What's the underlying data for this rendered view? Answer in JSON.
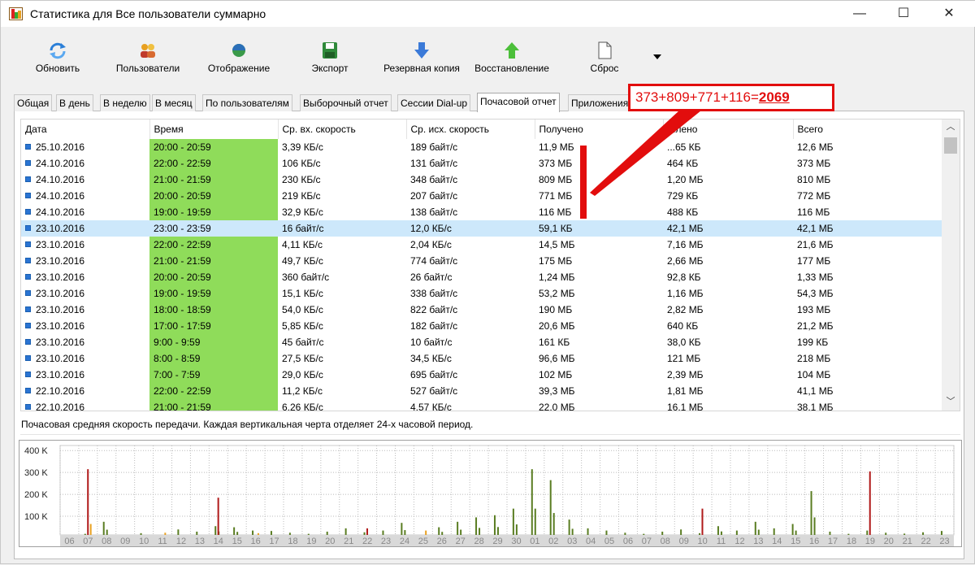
{
  "window": {
    "title": "Статистика для Все пользователи суммарно",
    "minimize": "—",
    "maximize": "☐",
    "close": "✕"
  },
  "toolbar": {
    "refresh": "Обновить",
    "users": "Пользователи",
    "display": "Отображение",
    "export": "Экспорт",
    "backup": "Резервная копия",
    "restore": "Восстановление",
    "reset": "Сброс"
  },
  "tabs": [
    "Общая",
    "В день",
    "В неделю",
    "В месяц",
    "По пользователям",
    "Выборочный отчет",
    "Сессии Dial-up",
    "Почасовой отчет",
    "Приложения"
  ],
  "active_tab": "Почасовой отчет",
  "table": {
    "columns": [
      "Дата",
      "Время",
      "Ср. вх. скорость",
      "Ср. исх. скорость",
      "Получено",
      "Отправлено",
      "Всего"
    ],
    "columns_visible": [
      "Дата",
      "Время",
      "Ср. вх. скорость",
      "Ср. исх. скорость",
      "Получено",
      "...лено",
      "Всего"
    ],
    "rows": [
      {
        "date": "25.10.2016",
        "time": "20:00 - 20:59",
        "in": "3,39 КБ/с",
        "out": "189 байт/с",
        "recv": "11,9 МБ",
        "sent": "...65 КБ",
        "total": "12,6 МБ"
      },
      {
        "date": "24.10.2016",
        "time": "22:00 - 22:59",
        "in": "106 КБ/с",
        "out": "131 байт/с",
        "recv": "373 МБ",
        "sent": "464 КБ",
        "total": "373 МБ"
      },
      {
        "date": "24.10.2016",
        "time": "21:00 - 21:59",
        "in": "230 КБ/с",
        "out": "348 байт/с",
        "recv": "809 МБ",
        "sent": "1,20 МБ",
        "total": "810 МБ"
      },
      {
        "date": "24.10.2016",
        "time": "20:00 - 20:59",
        "in": "219 КБ/с",
        "out": "207 байт/с",
        "recv": "771 МБ",
        "sent": "729 КБ",
        "total": "772 МБ"
      },
      {
        "date": "24.10.2016",
        "time": "19:00 - 19:59",
        "in": "32,9 КБ/с",
        "out": "138 байт/с",
        "recv": "116 МБ",
        "sent": "488 КБ",
        "total": "116 МБ"
      },
      {
        "date": "23.10.2016",
        "time": "23:00 - 23:59",
        "in": "16 байт/с",
        "out": "12,0 КБ/с",
        "recv": "59,1 КБ",
        "sent": "42,1 МБ",
        "total": "42,1 МБ",
        "selected": true
      },
      {
        "date": "23.10.2016",
        "time": "22:00 - 22:59",
        "in": "4,11 КБ/с",
        "out": "2,04 КБ/с",
        "recv": "14,5 МБ",
        "sent": "7,16 МБ",
        "total": "21,6 МБ"
      },
      {
        "date": "23.10.2016",
        "time": "21:00 - 21:59",
        "in": "49,7 КБ/с",
        "out": "774 байт/с",
        "recv": "175 МБ",
        "sent": "2,66 МБ",
        "total": "177 МБ"
      },
      {
        "date": "23.10.2016",
        "time": "20:00 - 20:59",
        "in": "360 байт/с",
        "out": "26 байт/с",
        "recv": "1,24 МБ",
        "sent": "92,8 КБ",
        "total": "1,33 МБ"
      },
      {
        "date": "23.10.2016",
        "time": "19:00 - 19:59",
        "in": "15,1 КБ/с",
        "out": "338 байт/с",
        "recv": "53,2 МБ",
        "sent": "1,16 МБ",
        "total": "54,3 МБ"
      },
      {
        "date": "23.10.2016",
        "time": "18:00 - 18:59",
        "in": "54,0 КБ/с",
        "out": "822 байт/с",
        "recv": "190 МБ",
        "sent": "2,82 МБ",
        "total": "193 МБ"
      },
      {
        "date": "23.10.2016",
        "time": "17:00 - 17:59",
        "in": "5,85 КБ/с",
        "out": "182 байт/с",
        "recv": "20,6 МБ",
        "sent": "640 КБ",
        "total": "21,2 МБ"
      },
      {
        "date": "23.10.2016",
        "time": "9:00 - 9:59",
        "in": "45 байт/с",
        "out": "10 байт/с",
        "recv": "161 КБ",
        "sent": "38,0 КБ",
        "total": "199 КБ"
      },
      {
        "date": "23.10.2016",
        "time": "8:00 - 8:59",
        "in": "27,5 КБ/с",
        "out": "34,5 КБ/с",
        "recv": "96,6 МБ",
        "sent": "121 МБ",
        "total": "218 МБ"
      },
      {
        "date": "23.10.2016",
        "time": "7:00 - 7:59",
        "in": "29,0 КБ/с",
        "out": "695 байт/с",
        "recv": "102 МБ",
        "sent": "2,39 МБ",
        "total": "104 МБ"
      },
      {
        "date": "22.10.2016",
        "time": "22:00 - 22:59",
        "in": "11,2 КБ/с",
        "out": "527 байт/с",
        "recv": "39,3 МБ",
        "sent": "1,81 МБ",
        "total": "41,1 МБ"
      },
      {
        "date": "22.10.2016",
        "time": "21:00 - 21:59",
        "in": "6,26 КБ/с",
        "out": "4,57 КБ/с",
        "recv": "22,0 МБ",
        "sent": "16,1 МБ",
        "total": "38,1 МБ"
      }
    ]
  },
  "status_text": "Почасовая средняя скорость передачи. Каждая вертикальная черта отделяет 24-х часовой период.",
  "annotation": {
    "expr": "373+809+771+116=",
    "result": "2069",
    "color": "#e20d0d"
  },
  "chart_data": {
    "type": "bar",
    "y_ticks": [
      "400 K",
      "300 K",
      "200 K",
      "100 K"
    ],
    "ylim": [
      0,
      400
    ],
    "x_ticks": [
      "06",
      "07",
      "08",
      "09",
      "10",
      "11",
      "12",
      "13",
      "14",
      "15",
      "16",
      "17",
      "18",
      "19",
      "20",
      "21",
      "22",
      "23",
      "24",
      "25",
      "26",
      "27",
      "28",
      "29",
      "30",
      "01",
      "02",
      "03",
      "04",
      "05",
      "06",
      "07",
      "08",
      "09",
      "10",
      "11",
      "12",
      "13",
      "14",
      "15",
      "16",
      "17",
      "18",
      "19",
      "20",
      "21",
      "22",
      "23"
    ],
    "series": [
      {
        "color": "#5a7d22",
        "values": [
          0,
          5,
          60,
          0,
          8,
          0,
          25,
          15,
          40,
          35,
          20,
          18,
          10,
          5,
          15,
          30,
          12,
          20,
          55,
          0,
          35,
          60,
          80,
          90,
          120,
          300,
          250,
          70,
          30,
          20,
          10,
          5,
          15,
          25,
          8,
          40,
          20,
          60,
          30,
          50,
          200,
          15,
          5,
          20,
          10,
          6,
          12,
          18
        ]
      },
      {
        "color": "#b01a1a",
        "values": [
          0,
          300,
          0,
          0,
          0,
          0,
          0,
          0,
          170,
          0,
          0,
          0,
          0,
          0,
          0,
          0,
          30,
          0,
          0,
          0,
          0,
          0,
          0,
          0,
          0,
          0,
          0,
          0,
          0,
          0,
          0,
          0,
          0,
          0,
          120,
          0,
          0,
          0,
          0,
          0,
          0,
          0,
          0,
          290,
          0,
          0,
          0,
          0
        ]
      },
      {
        "color": "#e8a020",
        "values": [
          0,
          50,
          0,
          0,
          0,
          10,
          0,
          0,
          0,
          0,
          8,
          0,
          0,
          0,
          0,
          0,
          0,
          0,
          0,
          20,
          0,
          0,
          0,
          0,
          0,
          0,
          0,
          0,
          0,
          0,
          0,
          0,
          0,
          0,
          0,
          0,
          0,
          0,
          0,
          0,
          0,
          0,
          0,
          0,
          0,
          0,
          0,
          0
        ]
      }
    ]
  }
}
